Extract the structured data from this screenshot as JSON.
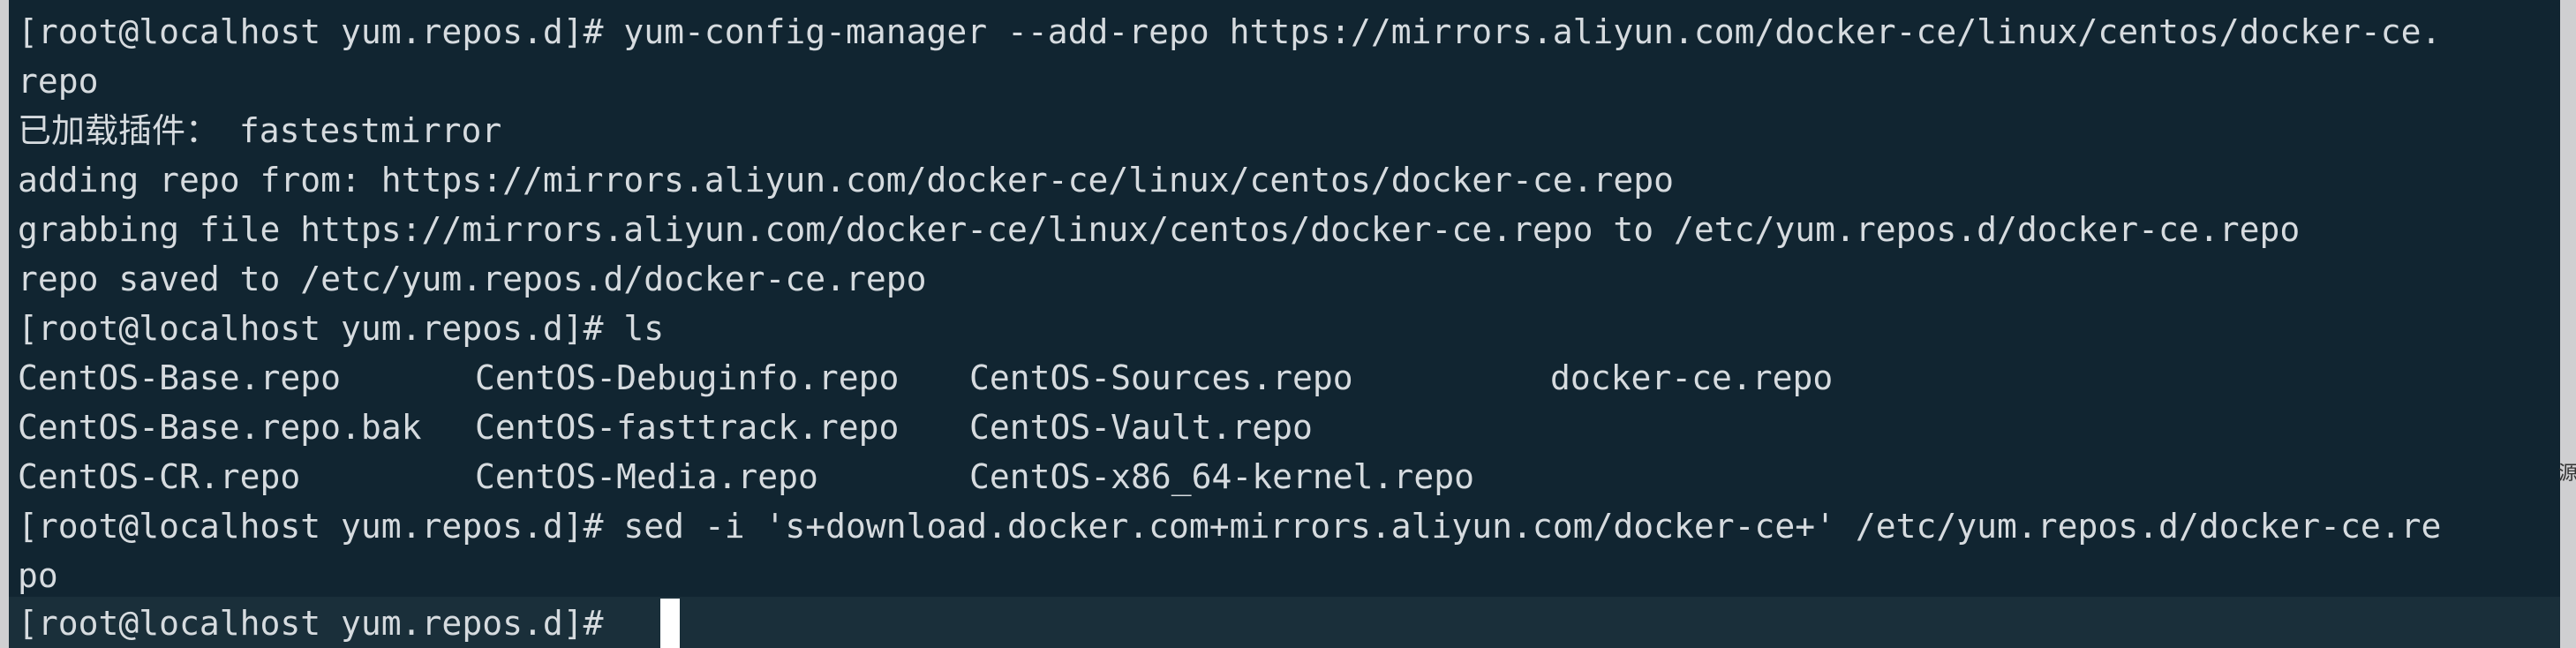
{
  "terminal": {
    "lines": [
      "[root@localhost yum.repos.d]# yum-config-manager --add-repo https://mirrors.aliyun.com/docker-ce/linux/centos/docker-ce.",
      "repo",
      "已加载插件： fastestmirror",
      "adding repo from: https://mirrors.aliyun.com/docker-ce/linux/centos/docker-ce.repo",
      "grabbing file https://mirrors.aliyun.com/docker-ce/linux/centos/docker-ce.repo to /etc/yum.repos.d/docker-ce.repo",
      "repo saved to /etc/yum.repos.d/docker-ce.repo",
      "[root@localhost yum.repos.d]# ls"
    ],
    "ls_output": [
      [
        "CentOS-Base.repo",
        "CentOS-Debuginfo.repo",
        "CentOS-Sources.repo",
        "docker-ce.repo"
      ],
      [
        "CentOS-Base.repo.bak",
        "CentOS-fasttrack.repo",
        "CentOS-Vault.repo",
        ""
      ],
      [
        "CentOS-CR.repo",
        "CentOS-Media.repo",
        "CentOS-x86_64-kernel.repo",
        ""
      ]
    ],
    "sed_line_1": "[root@localhost yum.repos.d]# sed -i 's+download.docker.com+mirrors.aliyun.com/docker-ce+' /etc/yum.repos.d/docker-ce.re",
    "sed_line_2": "po",
    "prompt": "[root@localhost yum.repos.d]# ",
    "edge_glyph": "源"
  }
}
